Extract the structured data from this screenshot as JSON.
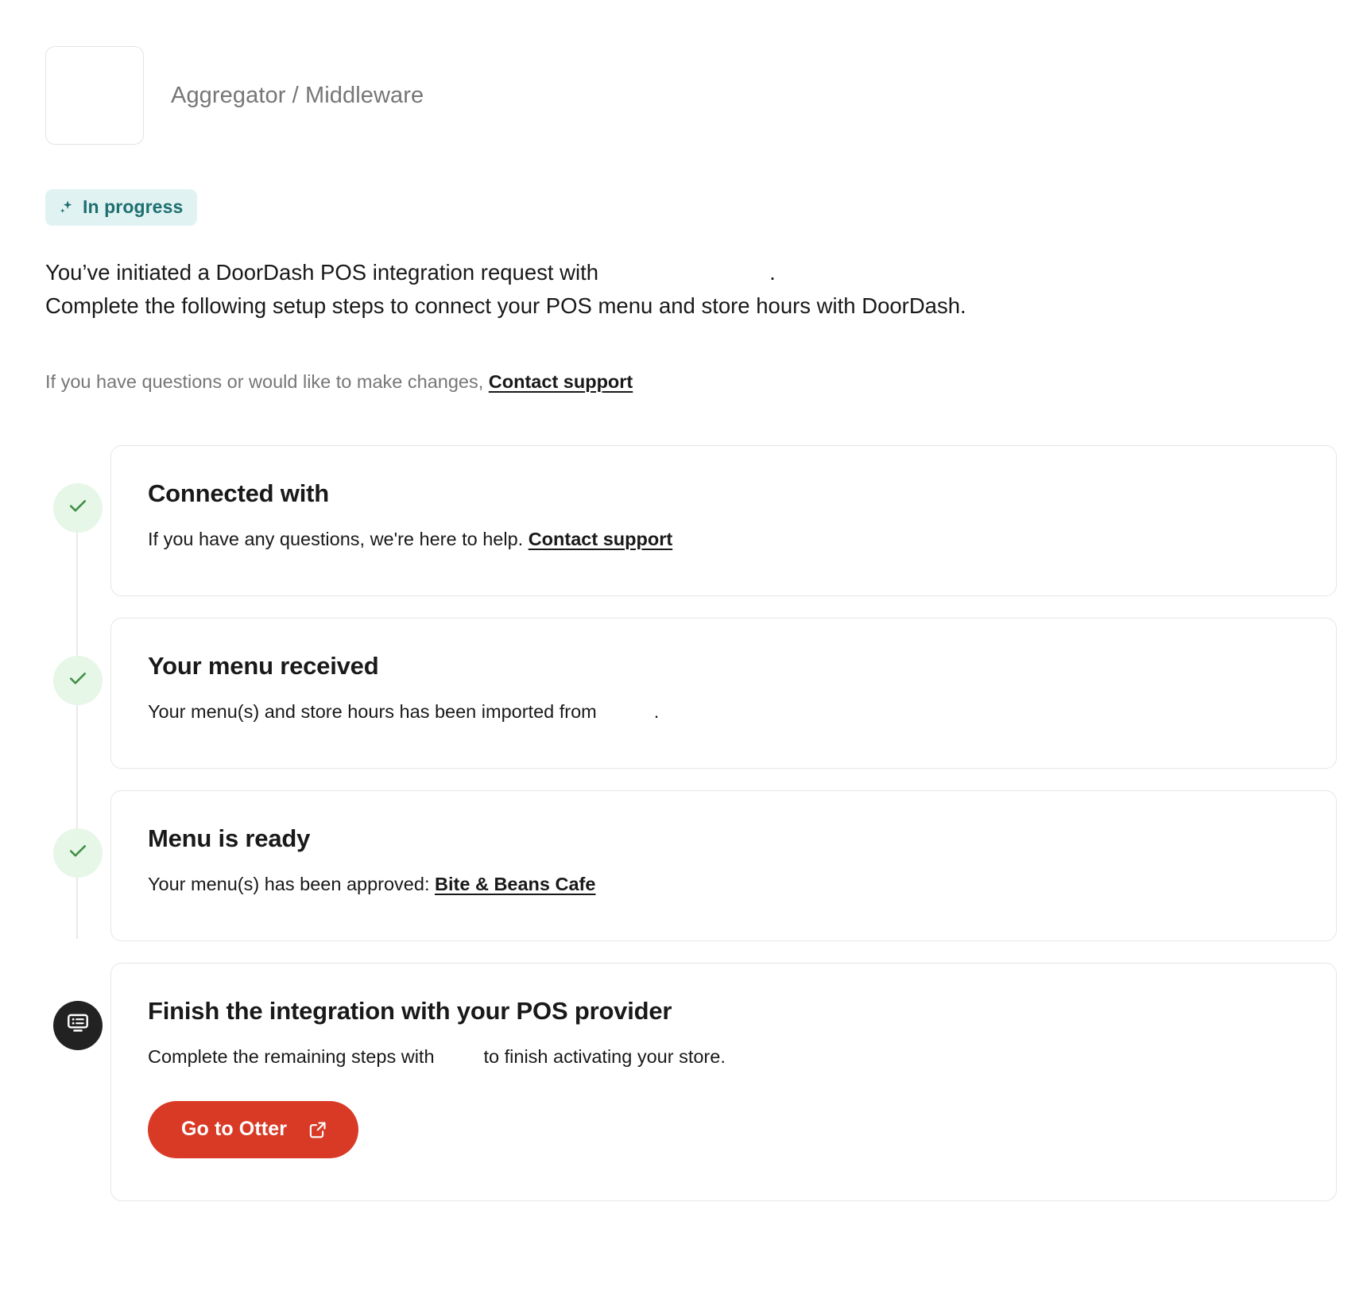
{
  "header": {
    "provider_label": "Aggregator / Middleware",
    "logo_alt": "provider-logo-placeholder"
  },
  "status": {
    "badge_label": "In progress",
    "badge_icon": "sparkle-icon",
    "badge_bg": "#e0f3f2",
    "badge_text_color": "#1f6f70"
  },
  "intro": {
    "line1_prefix": "You’ve initiated a DoorDash POS integration request with",
    "line1_suffix": ".",
    "line2": "Complete the following setup steps to connect your POS menu and store hours with DoorDash.",
    "support_prefix": "If you have questions or would like to make changes,",
    "support_link": "Contact support"
  },
  "timeline": {
    "steps": [
      {
        "status": "done",
        "marker_icon": "check-icon",
        "title": "Connected with",
        "desc_prefix": "If you have any questions, we're here to help.",
        "link": "Contact support",
        "desc_suffix": ""
      },
      {
        "status": "done",
        "marker_icon": "check-icon",
        "title": "Your menu received",
        "desc_prefix": "Your menu(s) and store hours has been imported from",
        "link": "",
        "desc_suffix": "."
      },
      {
        "status": "done",
        "marker_icon": "check-icon",
        "title": "Menu is ready",
        "desc_prefix": "Your menu(s) has been approved:",
        "link": "Bite & Beans Cafe",
        "desc_suffix": ""
      },
      {
        "status": "current",
        "marker_icon": "pos-terminal-icon",
        "title": "Finish the integration with your POS provider",
        "desc_prefix": "Complete the remaining steps with",
        "link": "",
        "desc_suffix": "to finish activating your store.",
        "cta_label": "Go to Otter",
        "cta_icon": "external-link-icon",
        "cta_color": "#d93a26"
      }
    ]
  },
  "colors": {
    "accent_red": "#d93a26",
    "check_green": "#3f8f45",
    "check_bg": "#e6f6e7",
    "marker_dark": "#222222",
    "text_primary": "#191919",
    "text_muted": "#767676",
    "border": "#e6e6e6"
  }
}
